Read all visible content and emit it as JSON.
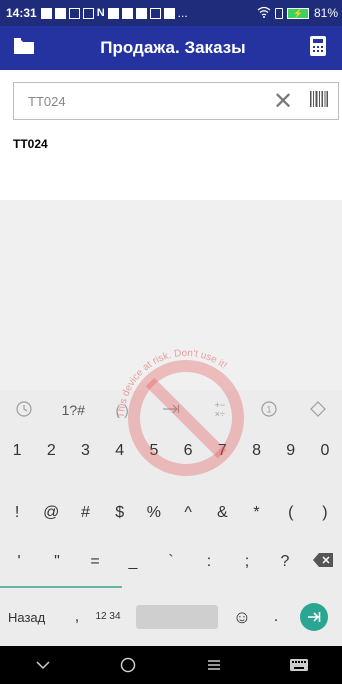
{
  "status_bar": {
    "time": "14:31",
    "ellipsis": "...",
    "battery_percent": "81%",
    "colors": {
      "background": "#1f2b7b",
      "battery": "#3bd35f"
    }
  },
  "app_bar": {
    "title": "Продажа. Заказы",
    "left_icon": "folder-icon",
    "right_icon": "calculator-icon",
    "color": "#2433a0"
  },
  "search": {
    "value": "ТТ024",
    "clear_icon": "close-icon",
    "barcode_icon": "barcode-icon"
  },
  "result_text": "ТТ024",
  "keyboard": {
    "toolbar": [
      "clock-icon",
      "1?#",
      "( )",
      "tab-arrow-icon",
      "+−×÷",
      "one-hand-icon",
      "diamond-icon"
    ],
    "toolbar_labels": {
      "symbols": "1?#",
      "parens": "( )",
      "math": "+−\n×÷"
    },
    "row1": [
      "1",
      "2",
      "3",
      "4",
      "5",
      "6",
      "7",
      "8",
      "9",
      "0"
    ],
    "row2": [
      "!",
      "@",
      "#",
      "$",
      "%",
      "^",
      "&",
      "*",
      "(",
      ")"
    ],
    "row3": [
      "'",
      "\"",
      "=",
      "_",
      "`",
      ":",
      ";",
      "?"
    ],
    "bottom": {
      "back_label": "Назад",
      "comma": ",",
      "numbers_label": "12 34",
      "dot": "."
    },
    "accent_color": "#2aa692"
  },
  "watermark": {
    "text": "This device at risk. Don't use it!"
  },
  "nav_bar": [
    "chevron-down-icon",
    "home-circle-icon",
    "menu-icon",
    "keyboard-icon"
  ]
}
